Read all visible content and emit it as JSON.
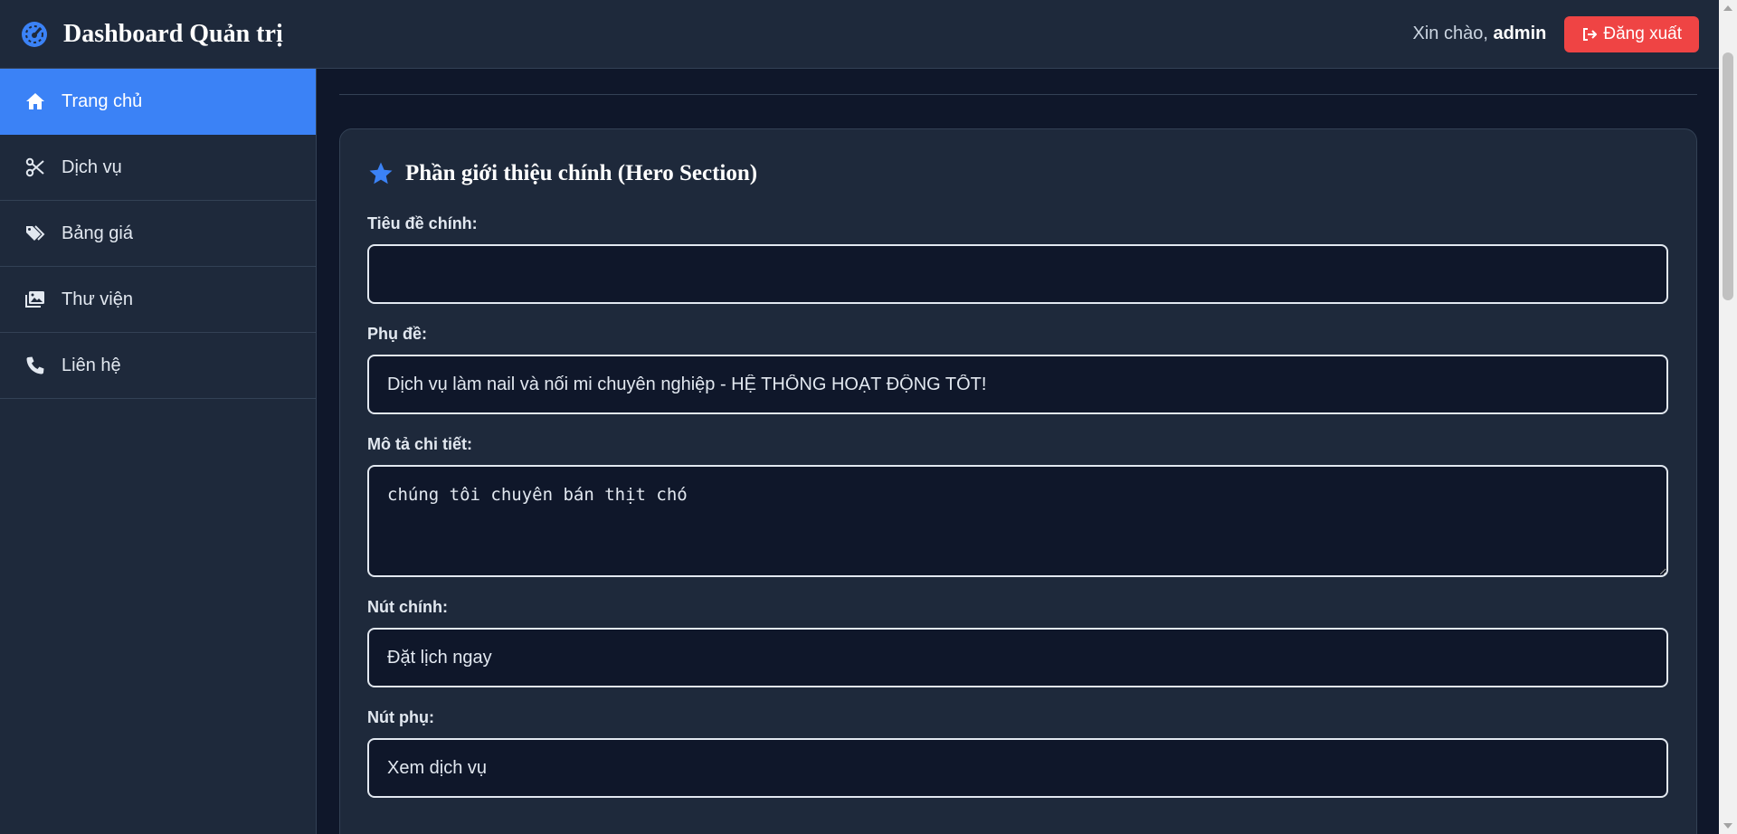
{
  "header": {
    "title": "Dashboard Quản trị",
    "greeting_prefix": "Xin chào, ",
    "username": "admin",
    "logout_label": "Đăng xuất"
  },
  "sidebar": {
    "items": [
      {
        "label": "Trang chủ",
        "icon": "home-icon",
        "active": true
      },
      {
        "label": "Dịch vụ",
        "icon": "scissors-icon",
        "active": false
      },
      {
        "label": "Bảng giá",
        "icon": "tags-icon",
        "active": false
      },
      {
        "label": "Thư viện",
        "icon": "images-icon",
        "active": false
      },
      {
        "label": "Liên hệ",
        "icon": "phone-icon",
        "active": false
      }
    ]
  },
  "main": {
    "hero_card": {
      "title": "Phần giới thiệu chính (Hero Section)",
      "fields": {
        "main_title": {
          "label": "Tiêu đề chính:",
          "value": ""
        },
        "subtitle": {
          "label": "Phụ đề:",
          "value": "Dịch vụ làm nail và nối mi chuyên nghiệp - HỆ THỐNG HOẠT ĐỘNG TỐT!"
        },
        "description": {
          "label": "Mô tả chi tiết:",
          "value": "chúng tôi chuyên bán thịt chó"
        },
        "primary_button": {
          "label": "Nút chính:",
          "value": "Đặt lịch ngay"
        },
        "secondary_button": {
          "label": "Nút phụ:",
          "value": "Xem dịch vụ"
        }
      }
    }
  },
  "colors": {
    "accent": "#3b82f6",
    "danger": "#ef4444",
    "background": "#0f172a",
    "panel": "#1e293b"
  }
}
